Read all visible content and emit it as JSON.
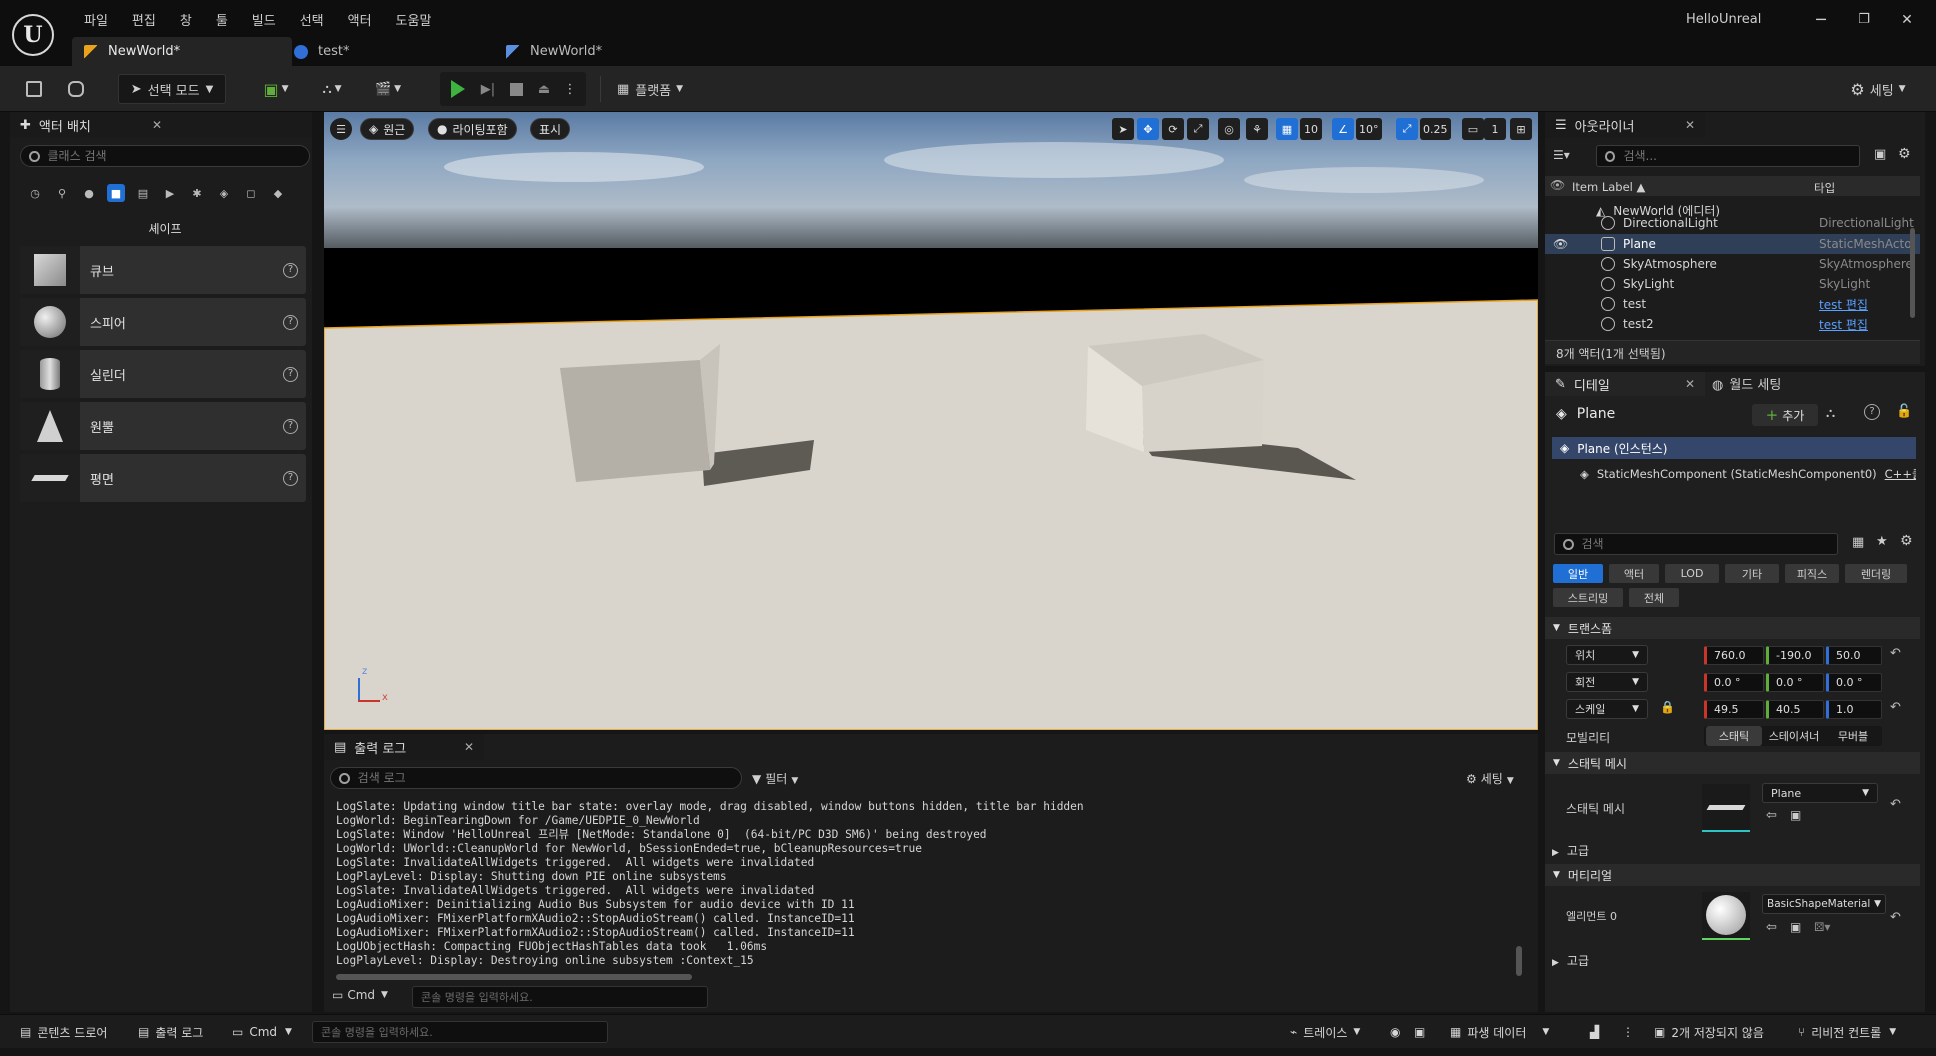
{
  "app": {
    "logo": "U",
    "window_title": "HelloUnreal",
    "min_icon": "─",
    "restore_icon": "❐",
    "close_icon": "✕"
  },
  "menu": [
    "파일",
    "편집",
    "창",
    "툴",
    "빌드",
    "선택",
    "액터",
    "도움말"
  ],
  "tabs": [
    {
      "label": "NewWorld*",
      "icon": "level-icon",
      "active": true
    },
    {
      "label": "test*",
      "icon": "blueprint-icon",
      "active": false
    },
    {
      "label": "NewWorld*",
      "icon": "level-icon",
      "active": false
    }
  ],
  "toolbar": {
    "select_mode": "선택 모드",
    "platforms": "플랫폼",
    "settings": "세팅"
  },
  "place_actors": {
    "title": "액터 배치",
    "search_placeholder": "클래스 검색",
    "category_label": "셰이프",
    "items": [
      {
        "label": "큐브",
        "shape": "cube"
      },
      {
        "label": "스피어",
        "shape": "sphere"
      },
      {
        "label": "실린더",
        "shape": "cylinder"
      },
      {
        "label": "원뿔",
        "shape": "cone"
      },
      {
        "label": "평면",
        "shape": "plane"
      }
    ]
  },
  "viewport": {
    "perspective": "원근",
    "lit": "라이팅포함",
    "show": "표시",
    "grid_snap": "10",
    "rot_snap": "10°",
    "scale_snap": "0.25",
    "camera_speed": "1",
    "axis_x": "x",
    "axis_z": "z"
  },
  "output_log": {
    "title": "출력 로그",
    "search_placeholder": "검색 로그",
    "filter": "필터",
    "settings": "세팅",
    "lines": [
      "LogSlate: Updating window title bar state: overlay mode, drag disabled, window buttons hidden, title bar hidden",
      "LogWorld: BeginTearingDown for /Game/UEDPIE_0_NewWorld",
      "LogSlate: Window 'HelloUnreal 프리뷰 [NetMode: Standalone 0]  (64-bit/PC D3D SM6)' being destroyed",
      "LogWorld: UWorld::CleanupWorld for NewWorld, bSessionEnded=true, bCleanupResources=true",
      "LogSlate: InvalidateAllWidgets triggered.  All widgets were invalidated",
      "LogPlayLevel: Display: Shutting down PIE online subsystems",
      "LogSlate: InvalidateAllWidgets triggered.  All widgets were invalidated",
      "LogAudioMixer: Deinitializing Audio Bus Subsystem for audio device with ID 11",
      "LogAudioMixer: FMixerPlatformXAudio2::StopAudioStream() called. InstanceID=11",
      "LogAudioMixer: FMixerPlatformXAudio2::StopAudioStream() called. InstanceID=11",
      "LogUObjectHash: Compacting FUObjectHashTables data took   1.06ms",
      "LogPlayLevel: Display: Destroying online subsystem :Context_15"
    ],
    "cmd": "Cmd",
    "cmd_placeholder": "콘솔 명령을 입력하세요."
  },
  "outliner": {
    "title": "아웃라이너",
    "search_placeholder": "검색...",
    "col_label": "Item Label ▲",
    "col_type": "타입",
    "world": "NewWorld (에디터)",
    "rows": [
      {
        "name": "DirectionalLight",
        "type": "DirectionalLight",
        "link": false,
        "selected": false
      },
      {
        "name": "Plane",
        "type": "StaticMeshActor",
        "link": false,
        "selected": true
      },
      {
        "name": "SkyAtmosphere",
        "type": "SkyAtmosphere",
        "link": false,
        "selected": false
      },
      {
        "name": "SkyLight",
        "type": "SkyLight",
        "link": false,
        "selected": false
      },
      {
        "name": "test",
        "type": "test 편집",
        "link": true,
        "selected": false
      },
      {
        "name": "test2",
        "type": "test 편집",
        "link": true,
        "selected": false
      }
    ],
    "footer": "8개 액터(1개 선택됨)"
  },
  "details": {
    "tab_details": "디테일",
    "tab_world": "월드 세팅",
    "object_name": "Plane",
    "add": "추가",
    "instance": "Plane (인스턴스)",
    "component": "StaticMeshComponent (StaticMeshComponent0)",
    "component_link": "C++클",
    "search_placeholder": "검색",
    "filters": [
      "일반",
      "액터",
      "LOD",
      "기타",
      "피직스",
      "렌더링",
      "스트리밍",
      "전체"
    ],
    "transform_title": "트랜스폼",
    "location_label": "위치",
    "rotation_label": "회전",
    "scale_label": "스케일",
    "location": [
      "760.0",
      "-190.0",
      "50.0"
    ],
    "rotation": [
      "0.0 °",
      "0.0 °",
      "0.0 °"
    ],
    "scale": [
      "49.5",
      "40.5",
      "1.0"
    ],
    "mobility_label": "모빌리티",
    "mobility": [
      "스태틱",
      "스테이셔너",
      "무버블"
    ],
    "static_mesh_section": "스태틱 메시",
    "static_mesh_label": "스태틱 메시",
    "static_mesh_value": "Plane",
    "advanced": "고급",
    "materials_section": "머티리얼",
    "element0_label": "엘리먼트 0",
    "material_value": "BasicShapeMaterial",
    "advanced2": "고급"
  },
  "status_bar": {
    "content_drawer": "콘텐츠 드로어",
    "output_log": "출력 로그",
    "cmd": "Cmd",
    "cmd_placeholder": "콘솔 명령을 입력하세요.",
    "trace": "트레이스",
    "derived_data": "파생 데이터",
    "unsaved": "2개 저장되지 않음",
    "revision": "리비전 컨트롤"
  },
  "colors": {
    "accent": "#1f6fd4",
    "play": "#3fb33f",
    "selection_border": "#e8a21b"
  }
}
